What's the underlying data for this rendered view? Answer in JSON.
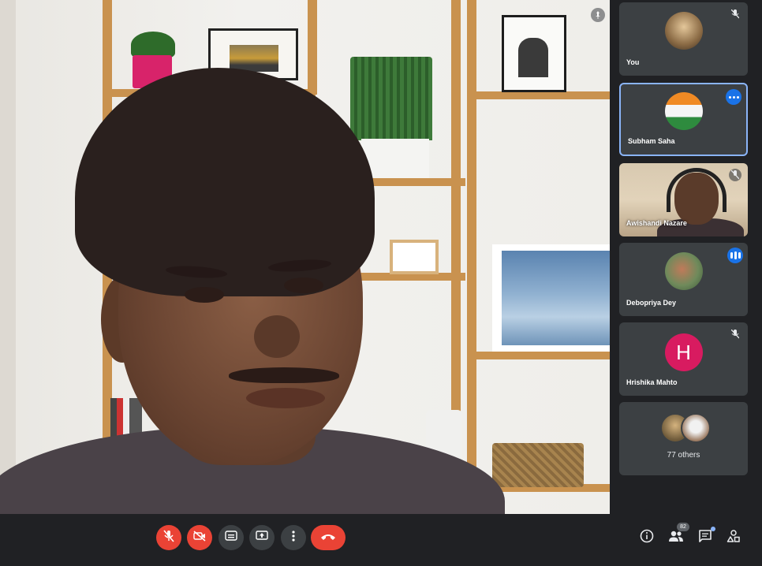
{
  "main_video": {
    "pin_icon": "pin-icon"
  },
  "participants": [
    {
      "name": "You",
      "type": "avatar",
      "icon": "mic-muted-icon",
      "highlighted": false
    },
    {
      "name": "Subham Saha",
      "type": "avatar",
      "icon": "more-options-icon",
      "highlighted": true
    },
    {
      "name": "Awishandi Nazare",
      "type": "video",
      "icon": "mic-muted-icon",
      "highlighted": false
    },
    {
      "name": "Debopriya Dey",
      "type": "avatar",
      "icon": "speaking-indicator-icon",
      "highlighted": false
    },
    {
      "name": "Hrishika Mahto",
      "type": "initial",
      "initial": "H",
      "icon": "mic-muted-icon",
      "highlighted": false
    },
    {
      "name": "77 others",
      "type": "others",
      "highlighted": false
    }
  ],
  "controls": {
    "mic": {
      "icon": "mic-off-icon",
      "state": "off"
    },
    "camera": {
      "icon": "camera-off-icon",
      "state": "off"
    },
    "captions": {
      "icon": "captions-icon"
    },
    "present": {
      "icon": "present-screen-icon"
    },
    "more": {
      "icon": "more-vertical-icon"
    },
    "hangup": {
      "icon": "hangup-icon"
    }
  },
  "side_controls": {
    "info": {
      "icon": "info-icon"
    },
    "people": {
      "icon": "people-icon",
      "count": "82"
    },
    "chat": {
      "icon": "chat-icon"
    },
    "activities": {
      "icon": "activities-icon"
    }
  },
  "colors": {
    "background": "#202124",
    "tile": "#3c4043",
    "accent_blue": "#1a73e8",
    "danger_red": "#ea4335",
    "avatar_pink": "#d81b60"
  }
}
